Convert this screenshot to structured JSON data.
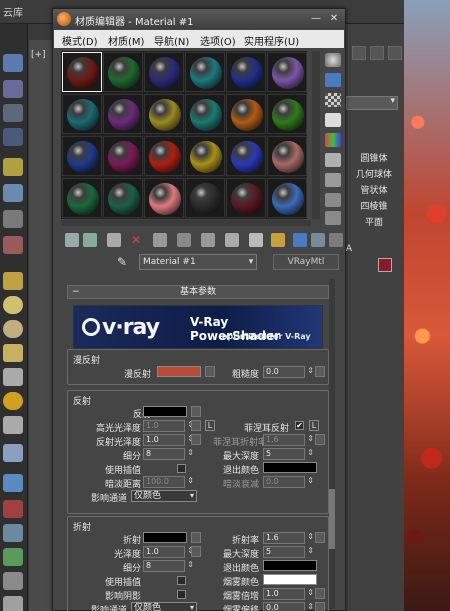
{
  "background": {
    "app_title": "云库",
    "viewport_label": "[+]",
    "command_panel": {
      "items": [
        "圆锥体",
        "几何球体",
        "管状体",
        "四棱锥",
        "平面"
      ],
      "section": "A"
    }
  },
  "window": {
    "title": "材质编辑器 - Material #1",
    "menu": [
      "模式(D)",
      "材质(M)",
      "导航(N)",
      "选项(O)",
      "实用程序(U)"
    ]
  },
  "slots": {
    "colors": [
      [
        "#6e1a12",
        "#1e6a2e",
        "#2a2a7a",
        "#1c7a80",
        "#1e2f8a",
        "#7a56a8"
      ],
      [
        "#1a6a74",
        "#6a2a7a",
        "#9a8a20",
        "#1a7a72",
        "#b05a14",
        "#2e7a1a"
      ],
      [
        "#1e3a8a",
        "#7a1a56",
        "#b01e12",
        "#a8901a",
        "#2a38b8",
        "#a86a64"
      ],
      [
        "#1a6a3a",
        "#1a6048",
        "#e07a80",
        "#2a2a2a",
        "#5a1820",
        "#3a6ab8"
      ]
    ],
    "active_index": 0
  },
  "editor": {
    "material_name": "Material #1",
    "material_type": "VRayMtl",
    "rollout_title": "基本参数",
    "banner": {
      "logo": "v·ray",
      "product": "V-Ray PowerShader",
      "tagline": "optimized for V-Ray"
    },
    "diffuse": {
      "group": "漫反射",
      "label": "漫反射",
      "color": "#b84a38",
      "roughness_label": "粗糙度",
      "roughness": "0.0"
    },
    "reflection": {
      "group": "反射",
      "reflect_label": "反射",
      "hilight_gloss_label": "高光光泽度",
      "hilight_gloss": "1.0",
      "refl_gloss_label": "反射光泽度",
      "refl_gloss": "1.0",
      "subdivs_label": "细分",
      "subdivs": "8",
      "use_interp_label": "使用插值",
      "dim_distance_label": "暗淡距离",
      "dim_distance": "100.0",
      "affect_channels_label": "影响通道",
      "affect_channels": "仅颜色",
      "fresnel_label": "菲涅耳反射",
      "fresnel_ior_label": "菲涅耳折射率",
      "fresnel_ior": "1.6",
      "max_depth_label": "最大深度",
      "max_depth": "5",
      "exit_color_label": "退出颜色",
      "dim_falloff_label": "暗淡衰减",
      "dim_falloff": "0.0",
      "l_label": "L"
    },
    "refraction": {
      "group": "折射",
      "refract_label": "折射",
      "gloss_label": "光泽度",
      "gloss": "1.0",
      "subdivs_label": "细分",
      "subdivs": "8",
      "use_interp_label": "使用插值",
      "affect_shadows_label": "影响阴影",
      "affect_channels_label": "影响通道",
      "affect_channels": "仅颜色",
      "ior_label": "折射率",
      "ior": "1.6",
      "max_depth_label": "最大深度",
      "max_depth": "5",
      "exit_color_label": "退出颜色",
      "fog_color_label": "烟雾颜色",
      "fog_mult_label": "烟雾倍增",
      "fog_mult": "1.0",
      "fog_bias_label": "烟雾偏移",
      "fog_bias": "0.0"
    }
  }
}
